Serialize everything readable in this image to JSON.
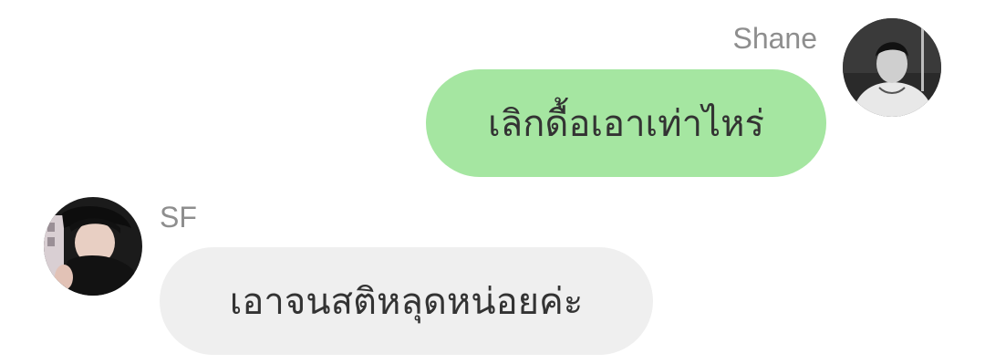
{
  "messages": [
    {
      "side": "right",
      "sender": "Shane",
      "text": "เลิกดื้อเอาเท่าไหร่",
      "bubble_color": "#a5e6a1",
      "avatar": "shane-avatar"
    },
    {
      "side": "left",
      "sender": "SF",
      "text": "เอาจนสติหลุดหน่อยค่ะ",
      "bubble_color": "#efefef",
      "avatar": "sf-avatar"
    }
  ],
  "colors": {
    "sender_name": "#8e8e8e",
    "message_text": "#333333",
    "background": "#ffffff"
  }
}
